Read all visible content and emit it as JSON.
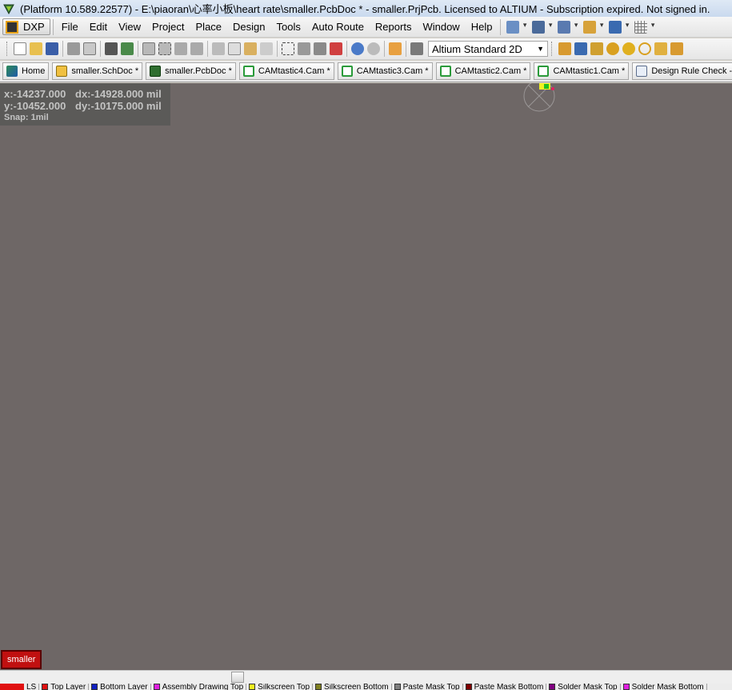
{
  "window": {
    "title": "(Platform 10.589.22577) - E:\\piaoran\\心率小板\\heart rate\\smaller.PcbDoc * - smaller.PrjPcb. Licensed to ALTIUM - Subscription expired. Not signed in."
  },
  "menubar": {
    "dxp_label": "DXP",
    "items": [
      "File",
      "Edit",
      "View",
      "Project",
      "Place",
      "Design",
      "Tools",
      "Auto Route",
      "Reports",
      "Window",
      "Help"
    ]
  },
  "toolbar": {
    "view_mode": "Altium Standard 2D"
  },
  "doc_tabs": [
    {
      "label": "Home",
      "icon": "home-icon"
    },
    {
      "label": "smaller.SchDoc *",
      "icon": "schematic-doc-icon"
    },
    {
      "label": "smaller.PcbDoc *",
      "icon": "pcb-doc-icon"
    },
    {
      "label": "CAMtastic4.Cam *",
      "icon": "cam-doc-icon"
    },
    {
      "label": "CAMtastic3.Cam *",
      "icon": "cam-doc-icon"
    },
    {
      "label": "CAMtastic2.Cam *",
      "icon": "cam-doc-icon"
    },
    {
      "label": "CAMtastic1.Cam *",
      "icon": "cam-doc-icon"
    },
    {
      "label": "Design Rule Check - smaller",
      "icon": "drc-doc-icon"
    }
  ],
  "hud": {
    "x": "x:-14237.000",
    "dx": "dx:-14928.000 mil",
    "y": "y:-10452.000",
    "dy": "dy:-10175.000 mil",
    "snap": "Snap: 1mil"
  },
  "board_tag": "smaller",
  "layers": [
    {
      "label": "LS",
      "color": "#e01010"
    },
    {
      "label": "Top Layer",
      "color": "#e01010"
    },
    {
      "label": "Bottom Layer",
      "color": "#1020c0"
    },
    {
      "label": "Assembly Drawing Top",
      "color": "#e020e0"
    },
    {
      "label": "Silkscreen Top",
      "color": "#f0f020"
    },
    {
      "label": "Silkscreen Bottom",
      "color": "#808020"
    },
    {
      "label": "Paste Mask Top",
      "color": "#808080"
    },
    {
      "label": "Paste Mask Bottom",
      "color": "#800000"
    },
    {
      "label": "Solder Mask Top",
      "color": "#800080"
    },
    {
      "label": "Solder Mask Bottom",
      "color": "#e020e0"
    }
  ],
  "colors": {
    "canvas": "#6e6766",
    "hud_bg": "#5a5a58",
    "board_tag": "#c01010"
  }
}
